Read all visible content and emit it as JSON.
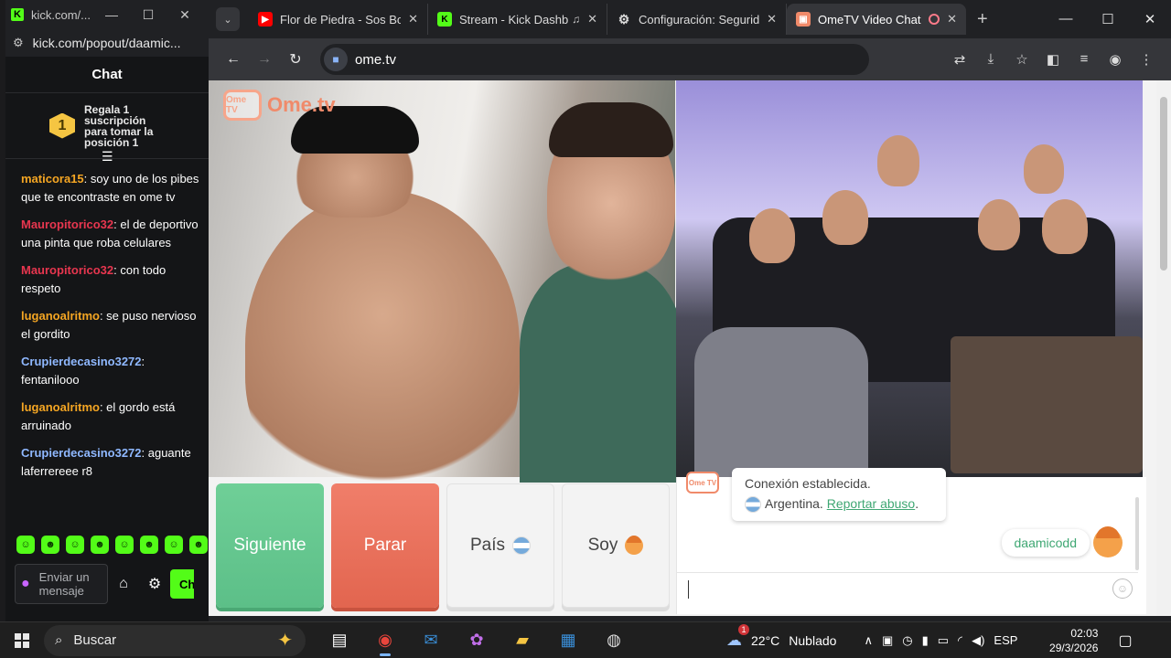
{
  "kick_window": {
    "title": "kick.com/...",
    "url": "kick.com/popout/daamic...",
    "chat_header": "Chat",
    "gift": {
      "rank": "1",
      "text": "Regala 1 suscripción para tomar la posición 1"
    },
    "messages": [
      {
        "user": "maticora15",
        "color": "#f5a623",
        "text": ": soy uno de los pibes que te encontraste en ome tv"
      },
      {
        "user": "Mauropitorico32",
        "color": "#e8364f",
        "text": ": el de deportivo una pinta que roba celulares"
      },
      {
        "user": "Mauropitorico32",
        "color": "#e8364f",
        "text": ": con todo respeto"
      },
      {
        "user": "luganoalritmo",
        "color": "#f5a623",
        "text": ": se puso nervioso el gordito"
      },
      {
        "user": "Crupierdecasino3272",
        "color": "#8fb8ff",
        "text": ": fentanilooo"
      },
      {
        "user": "luganoalritmo",
        "color": "#f5a623",
        "text": ": el gordo está arruinado"
      },
      {
        "user": "Crupierdecasino3272",
        "color": "#8fb8ff",
        "text": ": aguante laferrereee r8"
      }
    ],
    "send_placeholder": "Enviar un mensaje",
    "chat_button": "Ch"
  },
  "browser": {
    "tabs": [
      {
        "label": "Flor de Piedra - Sos Bot",
        "favicon": "youtube-icon",
        "color": "#ff0000"
      },
      {
        "label": "Stream - Kick Dashb",
        "favicon": "kick-icon",
        "color": "#53fc18"
      },
      {
        "label": "Configuración: Segurida",
        "favicon": "settings-icon",
        "color": "#9aa0a6"
      },
      {
        "label": "OmeTV Video Chat",
        "favicon": "ometv-icon",
        "color": "#f08a6a"
      }
    ],
    "url": "ome.tv"
  },
  "ometv": {
    "logo": "Ome.tv",
    "logo_small": "Ome TV",
    "buttons": {
      "next": "Siguiente",
      "stop": "Parar",
      "country": "País",
      "gender": "Soy"
    },
    "system_message": {
      "line1": "Conexión establecida.",
      "country": "Argentina.",
      "report": "Reportar abuso",
      "dot": "."
    },
    "my_message": "daamicodd"
  },
  "taskbar": {
    "search": "Buscar",
    "weather": {
      "temp": "22°C",
      "condition": "Nublado",
      "badge": "1"
    },
    "lang": "ESP",
    "time": "02:03",
    "date": "29/3/2026"
  }
}
